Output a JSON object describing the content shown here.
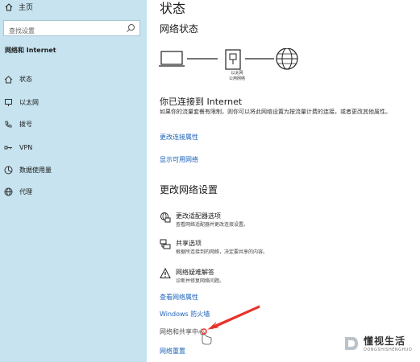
{
  "sidebar": {
    "home_label": "主页",
    "search": {
      "placeholder": "查找设置"
    },
    "section_title": "网络和 Internet",
    "items": [
      {
        "label": "状态",
        "icon": "home-status-icon"
      },
      {
        "label": "以太网",
        "icon": "ethernet-icon"
      },
      {
        "label": "拨号",
        "icon": "dialup-icon"
      },
      {
        "label": "VPN",
        "icon": "vpn-icon"
      },
      {
        "label": "数据使用量",
        "icon": "data-usage-icon"
      },
      {
        "label": "代理",
        "icon": "globe-icon"
      }
    ]
  },
  "main": {
    "title": "状态",
    "network_status_heading": "网络状态",
    "diagram": {
      "adapter_label_line1": "以太网",
      "adapter_label_line2": "公用网络"
    },
    "connected_title": "你已连接到 Internet",
    "connected_desc": "如果你的流量套餐有限制，则你可以将此网络设置为按流量计费的连接，或者更改其他属性。",
    "links": {
      "change_connection_props": "更改连接属性",
      "show_available_networks": "显示可用网络"
    },
    "change_settings_heading": "更改网络设置",
    "settings": [
      {
        "title": "更改适配器选项",
        "desc": "查看网络适配器并更改连接设置。",
        "icon": "adapter-icon"
      },
      {
        "title": "共享选项",
        "desc": "根据所连接到的网络，决定要共享的内容。",
        "icon": "sharing-icon"
      },
      {
        "title": "网络疑难解答",
        "desc": "诊断并修复网络问题。",
        "icon": "warning-icon"
      }
    ],
    "bottom_links": {
      "view_properties": "查看网络属性",
      "firewall": "Windows 防火墙",
      "sharing_center": "网络和共享中心",
      "reset": "网络重置"
    }
  },
  "watermark": {
    "main": "懂视生活",
    "sub": "DONGSHISHENGHUO"
  },
  "colors": {
    "sidebar_bg": "#c6e3ef",
    "link": "#1a62b8",
    "arrow": "#e8332a"
  }
}
